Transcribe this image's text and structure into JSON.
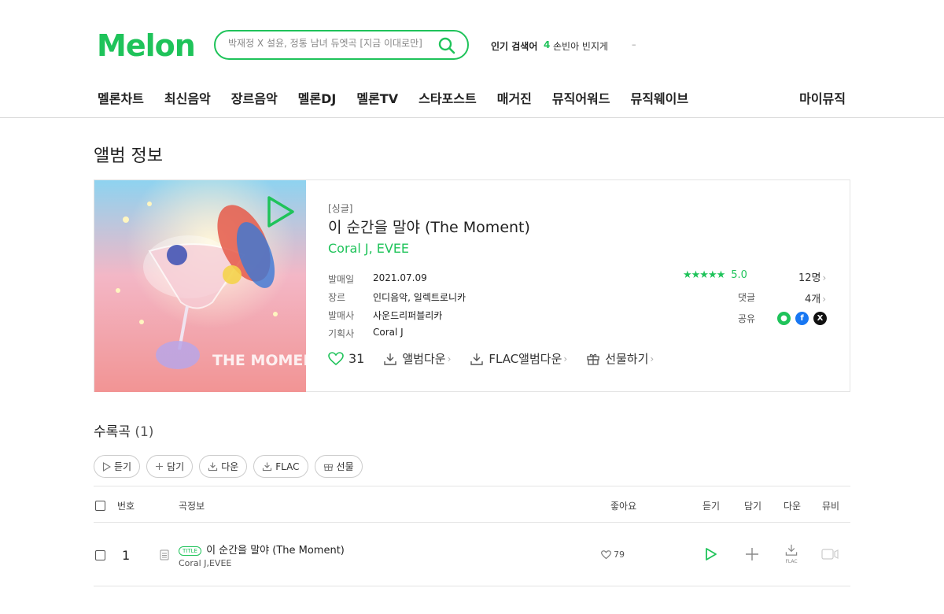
{
  "header": {
    "logo": "Melon",
    "search_placeholder": "박재정 X 설윤, 정통 남녀 듀엣곡 [지금 이대로만]",
    "popular_label": "인기 검색어",
    "popular_rank": "4",
    "popular_word": "손빈아 빈지게",
    "popular_change": "–"
  },
  "nav": {
    "items": [
      "멜론차트",
      "최신음악",
      "장르음악",
      "멜론DJ",
      "멜론TV",
      "스타포스트",
      "매거진",
      "뮤직어워드",
      "뮤직웨이브"
    ],
    "mymusic": "마이뮤직"
  },
  "album": {
    "section_title": "앨범 정보",
    "type": "[싱글]",
    "title": "이 순간을 말야 (The Moment)",
    "artist": "Coral J, EVEE",
    "meta": [
      {
        "key": "발매일",
        "value": "2021.07.09"
      },
      {
        "key": "장르",
        "value": "인디음악, 일렉트로니카"
      },
      {
        "key": "발매사",
        "value": "사운드리퍼블리카"
      },
      {
        "key": "기획사",
        "value": "Coral J"
      }
    ],
    "rating_stars": "★★★★★",
    "rating_score": "5.0",
    "rating_count": "12명",
    "comment_label": "댓글",
    "comment_count": "4개",
    "share_label": "공유",
    "likes": "31",
    "actions": {
      "download": "앨범다운",
      "flac": "FLAC앨범다운",
      "gift": "선물하기"
    },
    "cover_text": "THE MOMENT"
  },
  "tracklist": {
    "title": "수록곡",
    "count": "(1)",
    "buttons": {
      "play": "듣기",
      "add": "담기",
      "down": "다운",
      "flac": "FLAC",
      "gift": "선물"
    },
    "headers": {
      "num": "번호",
      "info": "곡정보",
      "like": "좋아요",
      "play": "듣기",
      "add": "담기",
      "down": "다운",
      "mv": "뮤비"
    },
    "rows": [
      {
        "num": "1",
        "badge": "TITLE",
        "title": "이 순간을 말야 (The Moment)",
        "artist": "Coral J,EVEE",
        "likes": "79",
        "flac_label": "FLAC"
      }
    ]
  },
  "colors": {
    "accent": "#1fc35a",
    "facebook": "#1877f2",
    "x": "#111111"
  }
}
